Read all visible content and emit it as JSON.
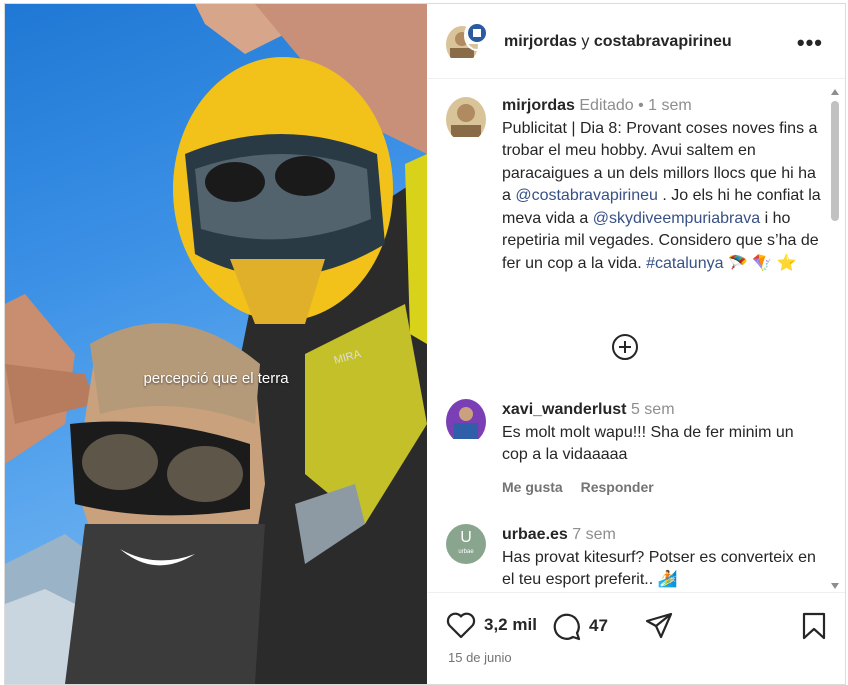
{
  "media": {
    "overlay_caption": "percepció que el terra",
    "helmet_brand": "MIRA"
  },
  "header": {
    "user1": "mirjordas",
    "joiner": "y",
    "user2": "costabravapirineu",
    "more_icon": "more-dots-icon"
  },
  "post_caption": {
    "username": "mirjordas",
    "edited": "Editado",
    "separator": "•",
    "time": "1 sem",
    "text_1": "Publicitat | Dia 8: Provant coses noves fins a trobar el meu hobby. Avui saltem en paracaigues a un dels millors llocs que hi ha a ",
    "mention_1": "@costabravapirineu",
    "text_2": " . Jo els hi he confiat la meva vida a ",
    "mention_2": "@skydiveempuriabrava",
    "text_3": " i ho repetiria mil vegades. Considero que s’ha de fer un cop a la vida. ",
    "hashtag": "#catalunya",
    "emojis": "🪂 🪁 ⭐"
  },
  "comments": [
    {
      "username": "xavi_wanderlust",
      "time": "5 sem",
      "text": "Es molt molt wapu!!! Sha de fer minim un cop a la vidaaaaa",
      "like": "Me gusta",
      "reply": "Responder"
    },
    {
      "username": "urbae.es",
      "time": "7 sem",
      "text": "Has provat kitesurf? Potser es converteix en el teu esport preferit.. 🏄",
      "avatar_letter": "U",
      "avatar_caption": "urbae"
    }
  ],
  "footer": {
    "likes": "3,2 mil",
    "comments": "47",
    "date": "15 de junio"
  },
  "colors": {
    "link": "#385185",
    "muted": "#8e8e8e",
    "helmet": "#f2c21a",
    "sky": "#3c91e6"
  }
}
